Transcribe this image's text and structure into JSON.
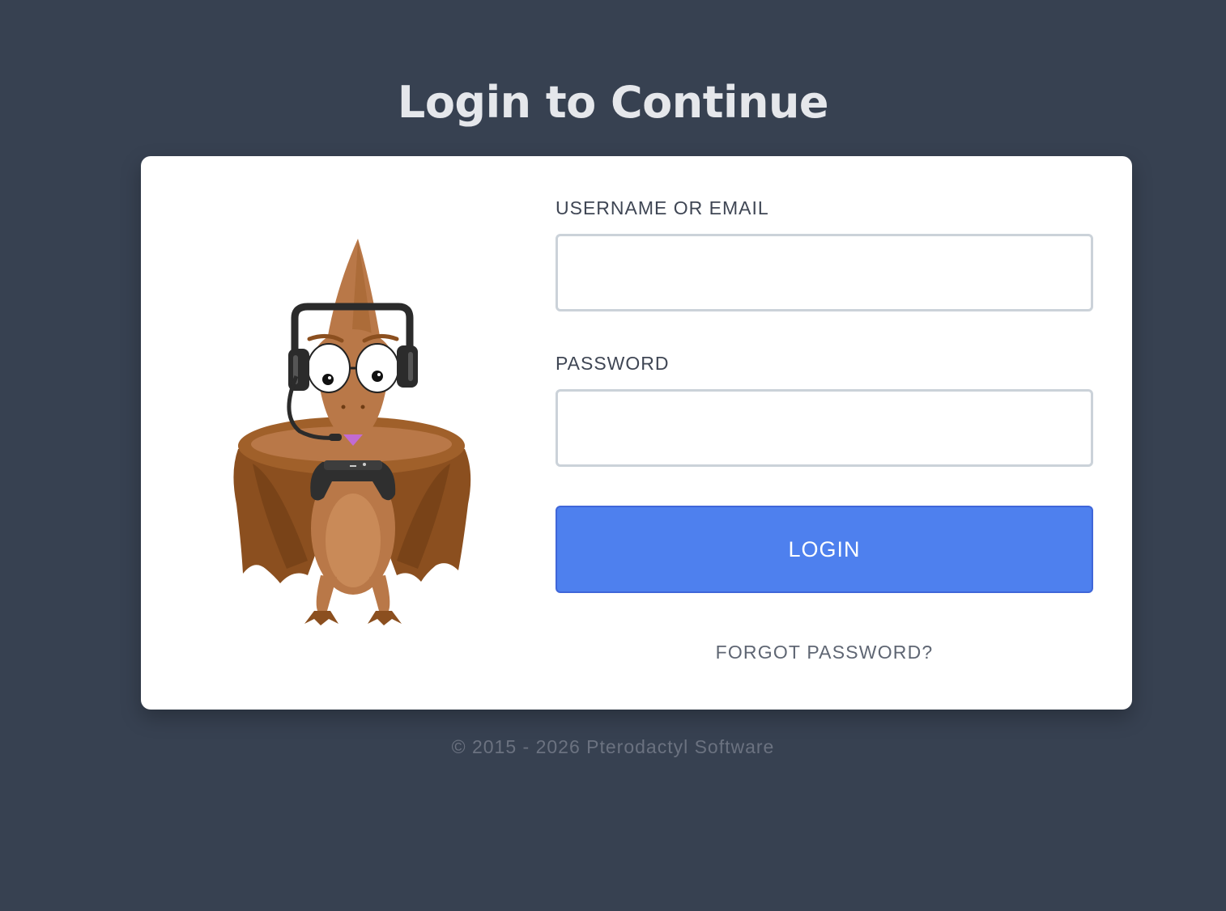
{
  "page": {
    "title": "Login to Continue",
    "background_color": "#374151"
  },
  "form": {
    "username_label": "USERNAME OR EMAIL",
    "username_value": "",
    "password_label": "PASSWORD",
    "password_value": "",
    "login_button_label": "LOGIN",
    "forgot_password_label": "FORGOT PASSWORD?",
    "accent_color": "#4e80ee"
  },
  "mascot": {
    "icon": "pterodactyl-gamer-mascot"
  },
  "footer": {
    "copyright": "© 2015 - 2026 Pterodactyl Software"
  }
}
